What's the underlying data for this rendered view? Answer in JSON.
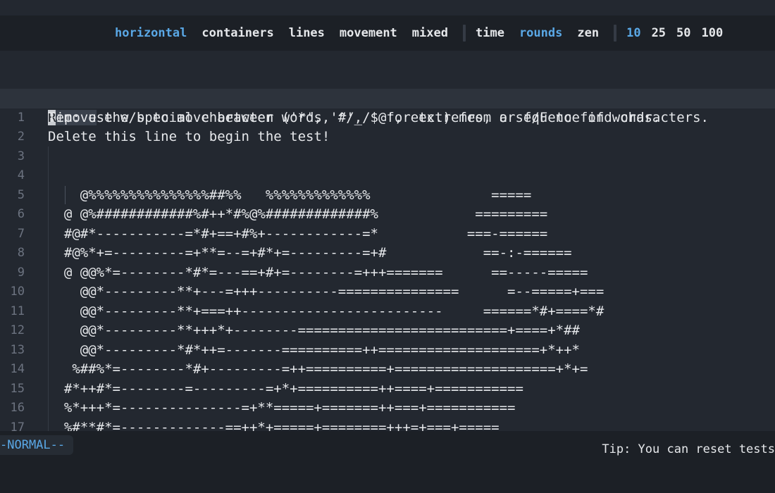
{
  "config_bar": {
    "modes": [
      {
        "label": "horizontal",
        "active": true
      },
      {
        "label": "containers",
        "active": false
      },
      {
        "label": "lines",
        "active": false
      },
      {
        "label": "movement",
        "active": false
      },
      {
        "label": "mixed",
        "active": false
      }
    ],
    "test_types": [
      {
        "label": "time",
        "active": false
      },
      {
        "label": "rounds",
        "active": true
      },
      {
        "label": "zen",
        "active": false
      }
    ],
    "counts": [
      {
        "label": "10",
        "active": true
      },
      {
        "label": "25",
        "active": false
      },
      {
        "label": "50",
        "active": false
      },
      {
        "label": "100",
        "active": false
      }
    ],
    "active_color": "#5aa8e6"
  },
  "editor": {
    "current_line": {
      "cursor_char": "R",
      "highlighted_rest": "emove",
      "rest": " the special character ('*', '#', '@', etc.) from a sequence of words."
    },
    "lines": [
      {
        "num": "1",
        "text": "Tip: use w/b to move between words, ^/_/$ for extremes, or f/F to find characters."
      },
      {
        "num": "2",
        "text": "Delete this line to begin the test!"
      },
      {
        "num": "3",
        "text": ""
      },
      {
        "num": "4",
        "text": ""
      },
      {
        "num": "5",
        "text": "    @%%%%%%%%%%%%%%%##%%   %%%%%%%%%%%%%               ====="
      },
      {
        "num": "6",
        "text": "  @ @%############%#++*#%@%#############%            ========="
      },
      {
        "num": "7",
        "text": "  #@#*-----------=*#+==+#%+------------=*           ===-======"
      },
      {
        "num": "8",
        "text": "  #@%*+=---------=+**=--=+#*+=---------=+#            ==-:-======"
      },
      {
        "num": "9",
        "text": "  @ @@%*=--------*#*=---==+#+=--------=+++=======      ==-----====="
      },
      {
        "num": "10",
        "text": "    @@*---------**+---=+++----------===============      =--=====+==="
      },
      {
        "num": "11",
        "text": "    @@*---------**+===++-------------------------     ======*#+====*#"
      },
      {
        "num": "12",
        "text": "    @@*---------**+++*+--------==========================+====+*##"
      },
      {
        "num": "13",
        "text": "    @@*---------*#*++=-------==========++====================+*++*"
      },
      {
        "num": "14",
        "text": "   %##%*=--------*#+---------=++==========+====================+*+="
      },
      {
        "num": "15",
        "text": "  #*++#*=--------=---------=+*+==========++====+==========="
      },
      {
        "num": "16",
        "text": "  %*+++*=---------------=+**=====+=======++===+==========="
      },
      {
        "num": "17",
        "text": "  %#**#*=-------------==++*+=====+========+++=+===+====="
      }
    ]
  },
  "status_bar": {
    "mode": "-NORMAL--",
    "tip": "Tip: You can reset tests"
  }
}
